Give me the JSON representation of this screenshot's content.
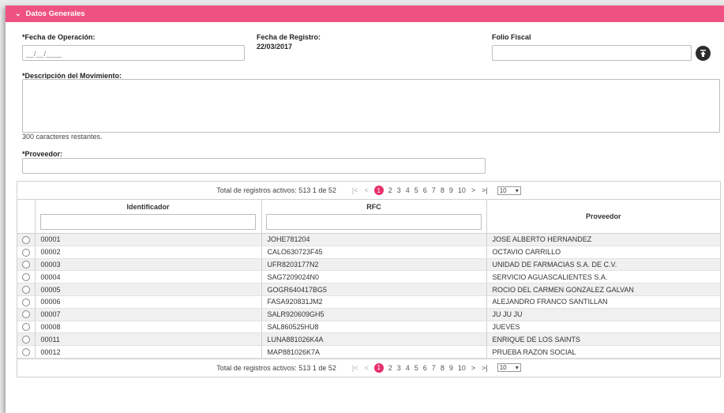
{
  "header": {
    "title": "Datos Generales"
  },
  "form": {
    "fecha_operacion": {
      "label": "*Fecha de Operación:",
      "placeholder": "__/__/____"
    },
    "fecha_registro": {
      "label": "Fecha de Registro:",
      "value": "22/03/2017"
    },
    "folio_fiscal": {
      "label": "Folio Fiscal",
      "value": ""
    },
    "descripcion": {
      "label": "*Descripción del Movimiento:",
      "value": "",
      "helper": "300 caracteres restantes."
    },
    "proveedor": {
      "label": "*Proveedor:",
      "value": ""
    }
  },
  "pager": {
    "total_text": "Total de registros activos: 513 1 de 52",
    "first": "|<",
    "prev": "<",
    "pages": [
      "1",
      "2",
      "3",
      "4",
      "5",
      "6",
      "7",
      "8",
      "9",
      "10"
    ],
    "active_page": "1",
    "next": ">",
    "last": ">|",
    "page_size": "10"
  },
  "table": {
    "columns": [
      "Identificador",
      "RFC",
      "Proveedor"
    ],
    "rows": [
      {
        "id": "00001",
        "rfc": "JOHE781204",
        "proveedor": "JOSE ALBERTO HERNANDEZ"
      },
      {
        "id": "00002",
        "rfc": "CALO630723F45",
        "proveedor": "OCTAVIO CARRILLO"
      },
      {
        "id": "00003",
        "rfc": "UFR8203177N2",
        "proveedor": "UNIDAD DE FARMACIAS S.A. DE C.V."
      },
      {
        "id": "00004",
        "rfc": "SAG7209024N0",
        "proveedor": "SERVICIO AGUASCALIENTES S.A."
      },
      {
        "id": "00005",
        "rfc": "GOGR640417BG5",
        "proveedor": "ROCIO DEL CARMEN GONZALEZ GALVAN"
      },
      {
        "id": "00006",
        "rfc": "FASA920831JM2",
        "proveedor": "ALEJANDRO FRANCO SANTILLAN"
      },
      {
        "id": "00007",
        "rfc": "SALR920609GH5",
        "proveedor": "JU JU JU"
      },
      {
        "id": "00008",
        "rfc": "SAL860525HU8",
        "proveedor": "JUEVES"
      },
      {
        "id": "00011",
        "rfc": "LUNA881026K4A",
        "proveedor": "ENRIQUE DE LOS SAINTS"
      },
      {
        "id": "00012",
        "rfc": "MAP881026K7A",
        "proveedor": "PRUEBA RAZON SOCIAL"
      }
    ]
  },
  "colors": {
    "header": "#ef5282",
    "active_page": "#e6316b"
  },
  "icons": {
    "header_toggle": "chevron-down-icon",
    "upload": "upload-icon"
  }
}
